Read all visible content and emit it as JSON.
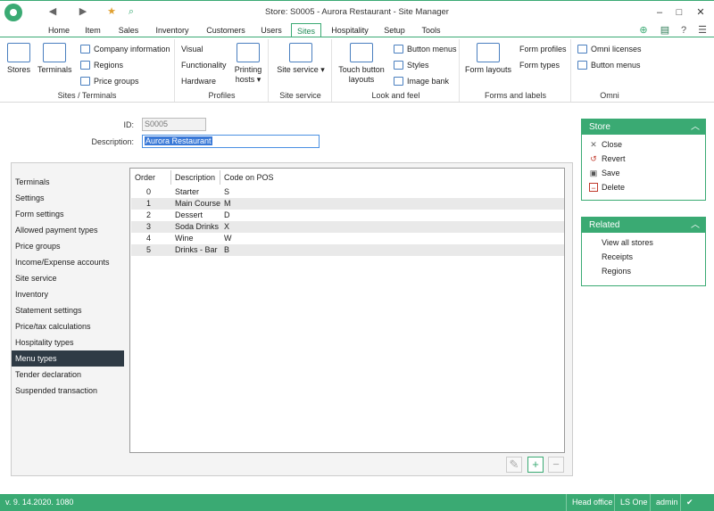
{
  "window": {
    "title": "Store: S0005 - Aurora Restaurant - Site Manager",
    "controls": [
      "–",
      "□",
      "✕"
    ]
  },
  "quick_access": [
    "◀",
    "▶",
    "★",
    "⌕"
  ],
  "tabs": [
    "Home",
    "Item",
    "Sales",
    "Inventory",
    "Customers",
    "Users",
    "Sites",
    "Hospitality",
    "Setup",
    "Tools"
  ],
  "active_tab": "Sites",
  "ribbon": {
    "groups": [
      {
        "title": "Sites / Terminals",
        "big": [
          "Stores",
          "Terminals"
        ],
        "small": [
          "Company information",
          "Regions",
          "Price groups"
        ]
      },
      {
        "title": "Profiles",
        "small": [
          "Visual",
          "Functionality",
          "Hardware"
        ],
        "big": [
          "Printing hosts ▾"
        ]
      },
      {
        "title": "Site service",
        "big": [
          "Site service ▾"
        ]
      },
      {
        "title": "Look and feel",
        "big": [
          "Touch button layouts"
        ],
        "small": [
          "Button menus",
          "Styles",
          "Image bank"
        ]
      },
      {
        "title": "Forms and labels",
        "big": [
          "Form layouts"
        ],
        "small": [
          "Form profiles",
          "Form types"
        ]
      },
      {
        "title": "Omni",
        "small": [
          "Omni licenses",
          "Button menus"
        ]
      }
    ]
  },
  "form": {
    "id_label": "ID:",
    "id_value": "S0005",
    "desc_label": "Description:",
    "desc_value": "Aurora Restaurant"
  },
  "nav": {
    "items": [
      "Terminals",
      "Settings",
      "Form settings",
      "Allowed payment types",
      "Price groups",
      "Income/Expense accounts",
      "Site service",
      "Inventory",
      "Statement settings",
      "Price/tax calculations",
      "Hospitality types",
      "Menu types",
      "Tender declaration",
      "Suspended transaction"
    ],
    "selected": "Menu types"
  },
  "grid": {
    "columns": [
      "Order",
      "Description",
      "Code on POS"
    ],
    "rows": [
      [
        "0",
        "Starter",
        "S"
      ],
      [
        "1",
        "Main Course",
        "M"
      ],
      [
        "2",
        "Dessert",
        "D"
      ],
      [
        "3",
        "Soda Drinks",
        "X"
      ],
      [
        "4",
        "Wine",
        "W"
      ],
      [
        "5",
        "Drinks - Bar",
        "B"
      ]
    ]
  },
  "store_panel": {
    "title": "Store",
    "items": [
      {
        "label": "Close",
        "icon": "close-icon",
        "glyph": "✕"
      },
      {
        "label": "Revert",
        "icon": "revert-icon",
        "glyph": "↺"
      },
      {
        "label": "Save",
        "icon": "save-icon",
        "glyph": "▣"
      },
      {
        "label": "Delete",
        "icon": "delete-icon",
        "glyph": "−"
      }
    ]
  },
  "related_panel": {
    "title": "Related",
    "items": [
      "View all stores",
      "Receipts",
      "Regions"
    ]
  },
  "status": {
    "version": "v. 9. 14.2020. 1080",
    "segments": [
      "Head office",
      "LS One",
      "admin"
    ]
  },
  "colors": {
    "accent": "#3aaa73",
    "selected_nav": "#2f3b45"
  }
}
